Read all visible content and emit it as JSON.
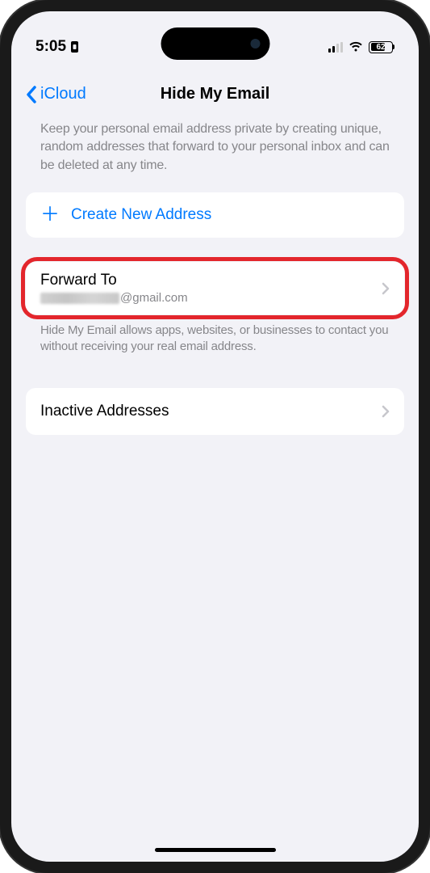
{
  "statusBar": {
    "time": "5:05",
    "batteryPercent": "62"
  },
  "nav": {
    "backLabel": "iCloud",
    "title": "Hide My Email"
  },
  "header": {
    "description": "Keep your personal email address private by creating unique, random addresses that forward to your personal inbox and can be deleted at any time."
  },
  "actions": {
    "createLabel": "Create New Address"
  },
  "forward": {
    "title": "Forward To",
    "emailDomain": "@gmail.com",
    "footer": "Hide My Email allows apps, websites, or businesses to contact you without receiving your real email address."
  },
  "inactive": {
    "title": "Inactive Addresses"
  }
}
